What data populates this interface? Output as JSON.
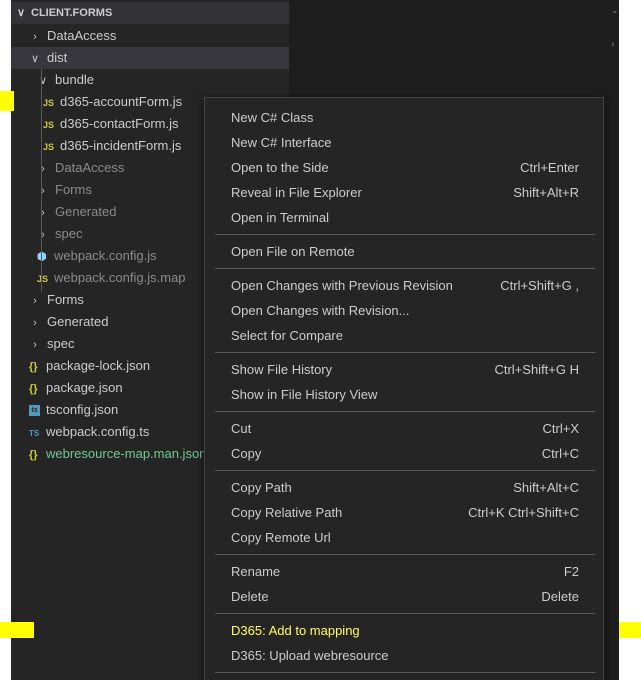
{
  "explorer": {
    "section_title": "CLIENT.FORMS",
    "items": [
      {
        "label": "DataAccess",
        "kind": "folder",
        "state": "collapsed"
      },
      {
        "label": "dist",
        "kind": "folder",
        "state": "expanded"
      },
      {
        "label": "bundle",
        "kind": "folder",
        "state": "expanded"
      },
      {
        "label": "d365-accountForm.js",
        "kind": "file",
        "icon": "js-file-icon",
        "icon_text": "JS"
      },
      {
        "label": "d365-contactForm.js",
        "kind": "file",
        "icon": "js-file-icon",
        "icon_text": "JS"
      },
      {
        "label": "d365-incidentForm.js",
        "kind": "file",
        "icon": "js-file-icon",
        "icon_text": "JS"
      },
      {
        "label": "DataAccess",
        "kind": "folder",
        "state": "collapsed"
      },
      {
        "label": "Forms",
        "kind": "folder",
        "state": "collapsed"
      },
      {
        "label": "Generated",
        "kind": "folder",
        "state": "collapsed"
      },
      {
        "label": "spec",
        "kind": "folder",
        "state": "collapsed"
      },
      {
        "label": "webpack.config.js",
        "kind": "file",
        "icon": "webpack-icon"
      },
      {
        "label": "webpack.config.js.map",
        "kind": "file",
        "icon": "js-file-icon",
        "icon_text": "JS"
      },
      {
        "label": "Forms",
        "kind": "folder",
        "state": "collapsed"
      },
      {
        "label": "Generated",
        "kind": "folder",
        "state": "collapsed"
      },
      {
        "label": "spec",
        "kind": "folder",
        "state": "collapsed"
      },
      {
        "label": "package-lock.json",
        "kind": "file",
        "icon": "json-icon",
        "icon_text": "{}"
      },
      {
        "label": "package.json",
        "kind": "file",
        "icon": "json-icon",
        "icon_text": "{}"
      },
      {
        "label": "tsconfig.json",
        "kind": "file",
        "icon": "tsconfig-icon",
        "icon_text": "ts"
      },
      {
        "label": "webpack.config.ts",
        "kind": "file",
        "icon": "typescript-icon",
        "icon_text": "TS"
      },
      {
        "label": "webresource-map.man.json",
        "kind": "file",
        "icon": "json-icon",
        "icon_text": "{}"
      }
    ]
  },
  "context_menu": {
    "groups": [
      [
        {
          "label": "New C# Class",
          "shortcut": ""
        },
        {
          "label": "New C# Interface",
          "shortcut": ""
        },
        {
          "label": "Open to the Side",
          "shortcut": "Ctrl+Enter"
        },
        {
          "label": "Reveal in File Explorer",
          "shortcut": "Shift+Alt+R"
        },
        {
          "label": "Open in Terminal",
          "shortcut": ""
        }
      ],
      [
        {
          "label": "Open File on Remote",
          "shortcut": ""
        }
      ],
      [
        {
          "label": "Open Changes with Previous Revision",
          "shortcut": "Ctrl+Shift+G ,"
        },
        {
          "label": "Open Changes with Revision...",
          "shortcut": ""
        },
        {
          "label": "Select for Compare",
          "shortcut": ""
        }
      ],
      [
        {
          "label": "Show File History",
          "shortcut": "Ctrl+Shift+G H"
        },
        {
          "label": "Show in File History View",
          "shortcut": ""
        }
      ],
      [
        {
          "label": "Cut",
          "shortcut": "Ctrl+X"
        },
        {
          "label": "Copy",
          "shortcut": "Ctrl+C"
        }
      ],
      [
        {
          "label": "Copy Path",
          "shortcut": "Shift+Alt+C"
        },
        {
          "label": "Copy Relative Path",
          "shortcut": "Ctrl+K Ctrl+Shift+C"
        },
        {
          "label": "Copy Remote Url",
          "shortcut": ""
        }
      ],
      [
        {
          "label": "Rename",
          "shortcut": "F2"
        },
        {
          "label": "Delete",
          "shortcut": "Delete"
        }
      ],
      [
        {
          "label": "D365: Add to mapping",
          "shortcut": ""
        },
        {
          "label": "D365: Upload webresource",
          "shortcut": ""
        }
      ]
    ]
  },
  "colors": {
    "sidebar_bg": "#252526",
    "editor_bg": "#1e1e1e",
    "menu_bg": "#252526",
    "highlight": "#ffff00",
    "js_icon": "#cbcb41",
    "ts_icon": "#519aba",
    "git_untracked": "#73c991"
  }
}
